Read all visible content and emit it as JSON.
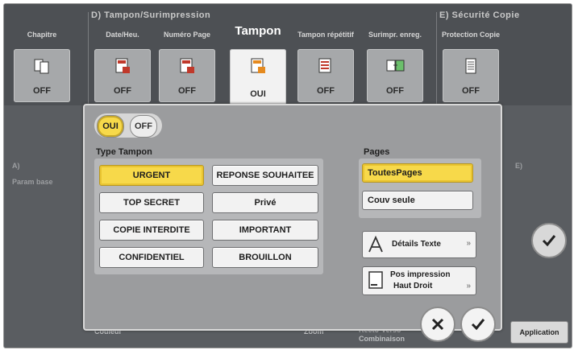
{
  "groups": {
    "stamp_group": "D) Tampon/Surimpression",
    "security_group": "E) Sécurité Copie"
  },
  "tabs": [
    {
      "label": "Chapitre",
      "state": "OFF",
      "icon": "chapter-icon"
    },
    {
      "label": "Date/Heu.",
      "state": "OFF",
      "icon": "date-stamp-icon"
    },
    {
      "label": "Numéro Page",
      "state": "OFF",
      "icon": "page-number-icon"
    },
    {
      "label": "Tampon",
      "state": "OUI",
      "icon": "stamp-icon",
      "active": true
    },
    {
      "label": "Tampon répétitif",
      "state": "OFF",
      "icon": "repeat-stamp-icon"
    },
    {
      "label": "Surimpr. enreg.",
      "state": "OFF",
      "icon": "overlay-icon"
    },
    {
      "label": "Protection Copie",
      "state": "OFF",
      "icon": "copy-protect-icon"
    }
  ],
  "toggle": {
    "on_label": "OUI",
    "off_label": "OFF"
  },
  "type_tampon": {
    "title": "Type Tampon",
    "buttons": [
      "URGENT",
      "REPONSE SOUHAITEE",
      "TOP SECRET",
      "Privé",
      "COPIE INTERDITE",
      "IMPORTANT",
      "CONFIDENTIEL",
      "BROUILLON"
    ],
    "selected": "URGENT"
  },
  "pages": {
    "title": "Pages",
    "options": [
      "ToutesPages",
      "Couv seule"
    ],
    "selected": "ToutesPages"
  },
  "tools": {
    "details_texte": "Détails Texte",
    "pos_impression": "Pos impression",
    "pos_value": "Haut Droit"
  },
  "background": {
    "left_a": "A)",
    "left_param": "Param base",
    "right_e": "E)",
    "couleur": "Couleur",
    "zoom": "Zoom",
    "recto_verso_1": "Recto-Verso",
    "recto_verso_2": "Combinaison",
    "application": "Application"
  },
  "colors": {
    "accent_yellow": "#f7d94a",
    "panel_grey": "#9b9c9e",
    "screen_dark": "#4d5054"
  }
}
